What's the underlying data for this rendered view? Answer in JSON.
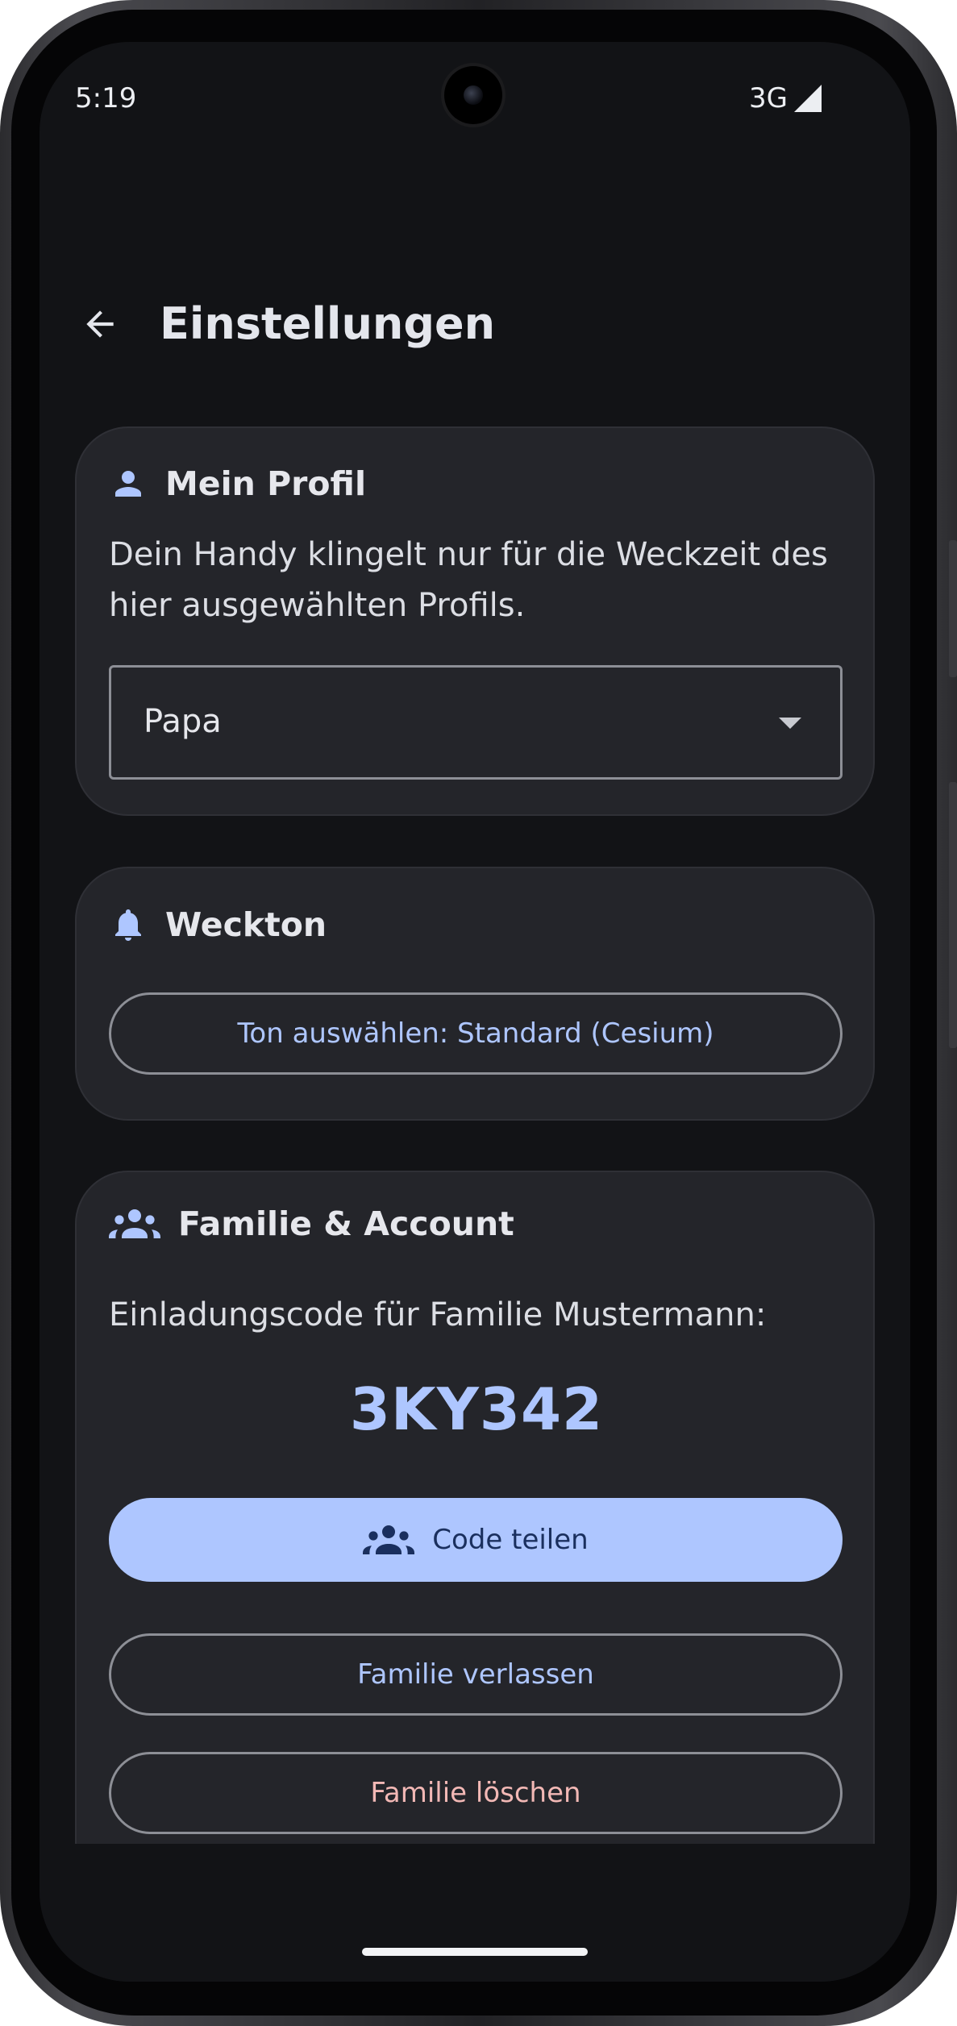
{
  "status_bar": {
    "time": "5:19",
    "network": "3G"
  },
  "header": {
    "title": "Einstellungen",
    "back_icon": "arrow-back-icon"
  },
  "profile_card": {
    "title": "Mein Profil",
    "icon": "person-icon",
    "description": "Dein Handy klingelt nur für die Weckzeit des hier ausgewählten Profils.",
    "selected_profile": "Papa"
  },
  "ringtone_card": {
    "title": "Weckton",
    "icon": "bell-icon",
    "button_label": "Ton auswählen: Standard (Cesium)"
  },
  "family_card": {
    "title": "Familie & Account",
    "icon": "group-icon",
    "invite_text": "Einladungscode für Familie Mustermann:",
    "invite_code": "3KY342",
    "share_label": "Code teilen",
    "leave_label": "Familie verlassen",
    "delete_label": "Familie löschen"
  },
  "colors": {
    "accent": "#aec6ff",
    "danger": "#f2b8b5",
    "background": "#121316",
    "card": "#24252a"
  }
}
